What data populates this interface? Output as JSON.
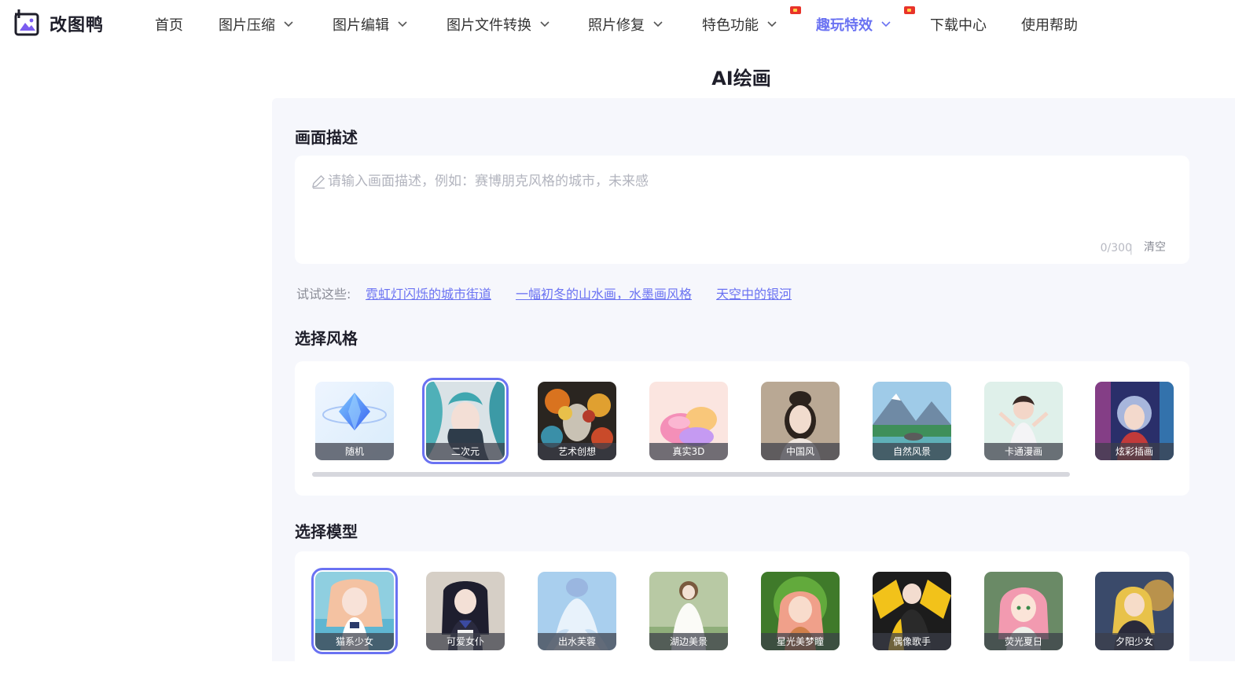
{
  "brand": {
    "name": "改图鸭"
  },
  "nav": {
    "items": [
      {
        "label": "首页",
        "has_dropdown": false,
        "active": false,
        "hot": false
      },
      {
        "label": "图片压缩",
        "has_dropdown": true,
        "active": false,
        "hot": false
      },
      {
        "label": "图片编辑",
        "has_dropdown": true,
        "active": false,
        "hot": false
      },
      {
        "label": "图片文件转换",
        "has_dropdown": true,
        "active": false,
        "hot": false
      },
      {
        "label": "照片修复",
        "has_dropdown": true,
        "active": false,
        "hot": false
      },
      {
        "label": "特色功能",
        "has_dropdown": true,
        "active": false,
        "hot": true
      },
      {
        "label": "趣玩特效",
        "has_dropdown": true,
        "active": true,
        "hot": true
      },
      {
        "label": "下载中心",
        "has_dropdown": false,
        "active": false,
        "hot": false
      },
      {
        "label": "使用帮助",
        "has_dropdown": false,
        "active": false,
        "hot": false
      }
    ]
  },
  "page": {
    "title": "AI绘画"
  },
  "description": {
    "section_title": "画面描述",
    "placeholder": "请输入画面描述，例如：赛博朋克风格的城市，未来感",
    "value": "",
    "counter": "0/300",
    "separator": "|",
    "clear_label": "清空"
  },
  "try_these": {
    "label": "试试这些:",
    "suggestions": [
      "霓虹灯闪烁的城市街道",
      "一幅初冬的山水画，水墨画风格",
      "天空中的银河"
    ]
  },
  "styles": {
    "section_title": "选择风格",
    "selected": "二次元",
    "items": [
      {
        "label": "随机",
        "icon": "diamond-icon"
      },
      {
        "label": "二次元",
        "icon": "anime-girl-thumbnail"
      },
      {
        "label": "艺术创想",
        "icon": "art-sculpture-thumbnail"
      },
      {
        "label": "真实3D",
        "icon": "3d-sofa-thumbnail"
      },
      {
        "label": "中国风",
        "icon": "chinese-girl-thumbnail"
      },
      {
        "label": "自然风景",
        "icon": "landscape-thumbnail"
      },
      {
        "label": "卡通漫画",
        "icon": "cartoon-girl-thumbnail"
      },
      {
        "label": "炫彩插画",
        "icon": "colorful-illustration-thumbnail"
      }
    ]
  },
  "models": {
    "section_title": "选择模型",
    "selected": "猫系少女",
    "items": [
      {
        "label": "猫系少女",
        "icon": "cat-girl-thumbnail"
      },
      {
        "label": "可爱女仆",
        "icon": "maid-thumbnail"
      },
      {
        "label": "出水芙蓉",
        "icon": "water-girl-thumbnail"
      },
      {
        "label": "湖边美景",
        "icon": "lake-girl-thumbnail"
      },
      {
        "label": "星光美梦瞳",
        "icon": "starlight-thumbnail"
      },
      {
        "label": "偶像歌手",
        "icon": "idol-singer-thumbnail"
      },
      {
        "label": "荧光夏日",
        "icon": "summer-girl-thumbnail"
      },
      {
        "label": "夕阳少女",
        "icon": "sunset-girl-thumbnail"
      }
    ]
  },
  "colors": {
    "accent": "#6a72f2",
    "panel_bg": "#f6f7fc",
    "hot_badge": "#e8332a"
  }
}
